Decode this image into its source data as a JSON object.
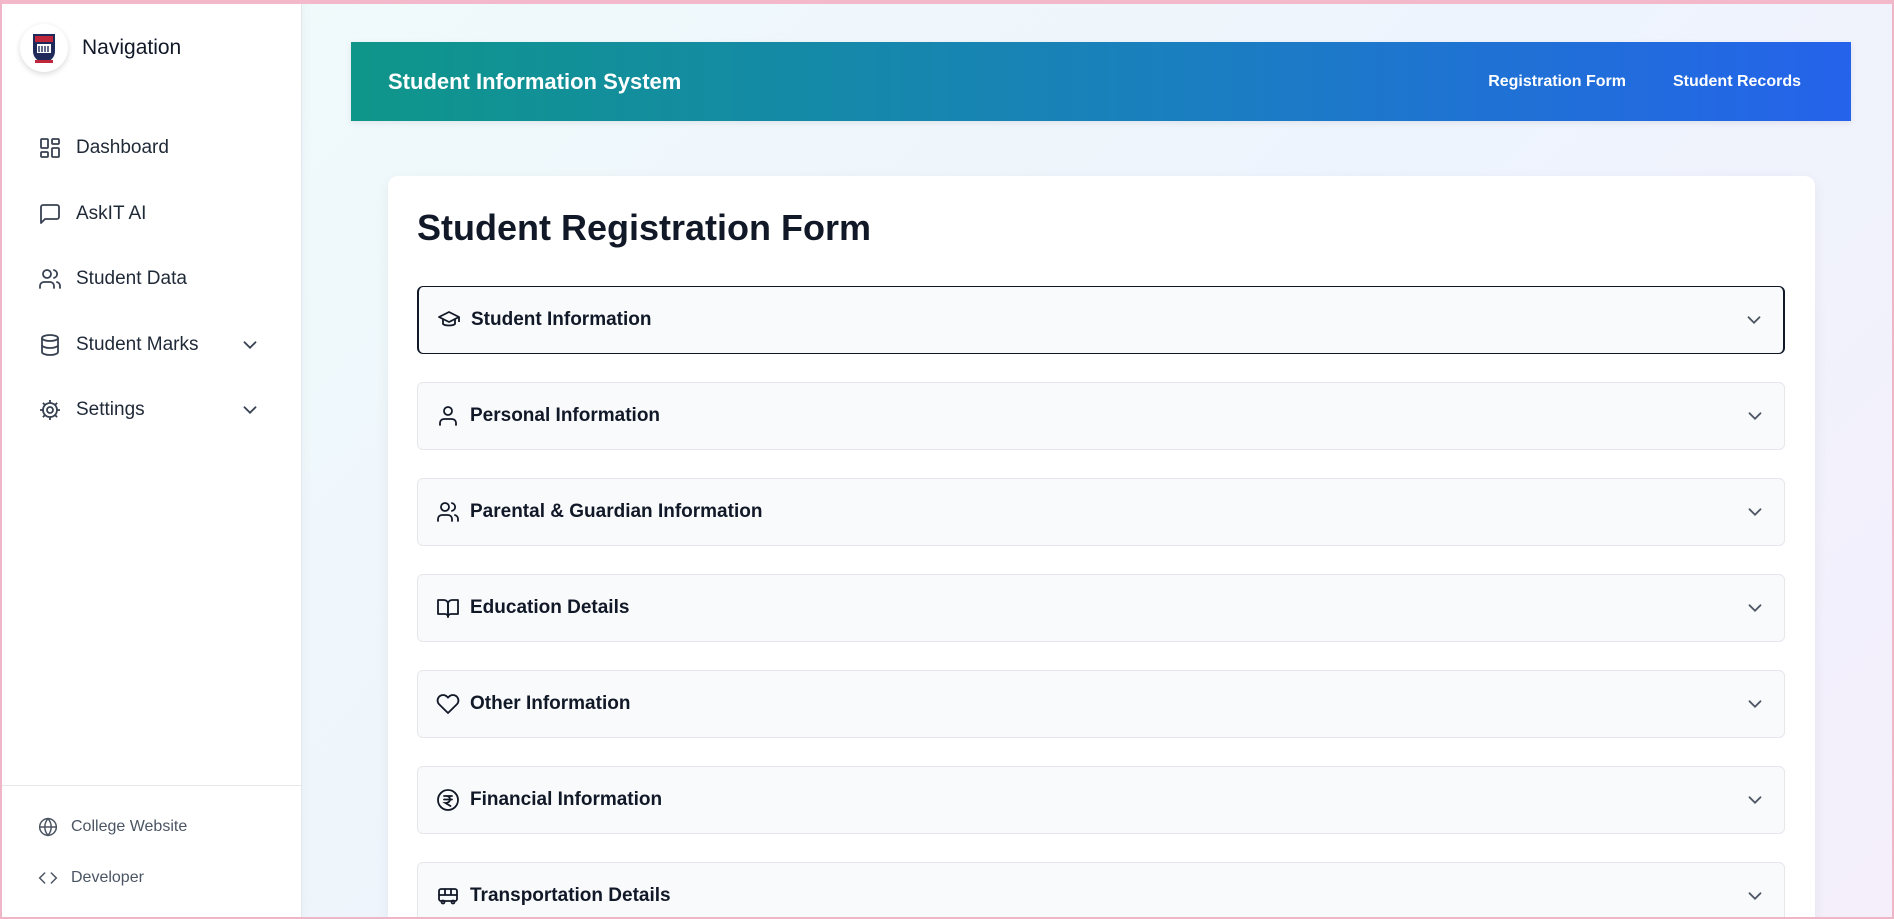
{
  "sidebar": {
    "brand_title": "Navigation",
    "logo_icon": "college-crest-logo",
    "items": [
      {
        "label": "Dashboard",
        "icon": "dashboard-icon",
        "expandable": false
      },
      {
        "label": "AskIT AI",
        "icon": "chat-icon",
        "expandable": false
      },
      {
        "label": "Student Data",
        "icon": "users-icon",
        "expandable": false
      },
      {
        "label": "Student Marks",
        "icon": "database-icon",
        "expandable": true
      },
      {
        "label": "Settings",
        "icon": "gear-icon",
        "expandable": true
      }
    ],
    "footer": [
      {
        "label": "College Website",
        "icon": "globe-icon"
      },
      {
        "label": "Developer",
        "icon": "code-icon"
      }
    ]
  },
  "header": {
    "title": "Student Information System",
    "links": [
      "Registration Form",
      "Student Records"
    ]
  },
  "form": {
    "title": "Student Registration Form",
    "sections": [
      {
        "label": "Student Information",
        "icon": "graduation-cap-icon"
      },
      {
        "label": "Personal Information",
        "icon": "user-icon"
      },
      {
        "label": "Parental & Guardian Information",
        "icon": "users-icon"
      },
      {
        "label": "Education Details",
        "icon": "book-open-icon"
      },
      {
        "label": "Other Information",
        "icon": "heart-icon"
      },
      {
        "label": "Financial Information",
        "icon": "rupee-circle-icon"
      },
      {
        "label": "Transportation Details",
        "icon": "bus-icon"
      }
    ]
  },
  "colors": {
    "header_gradient_start": "#0f968a",
    "header_gradient_end": "#2563eb",
    "text_dark": "#111827"
  }
}
